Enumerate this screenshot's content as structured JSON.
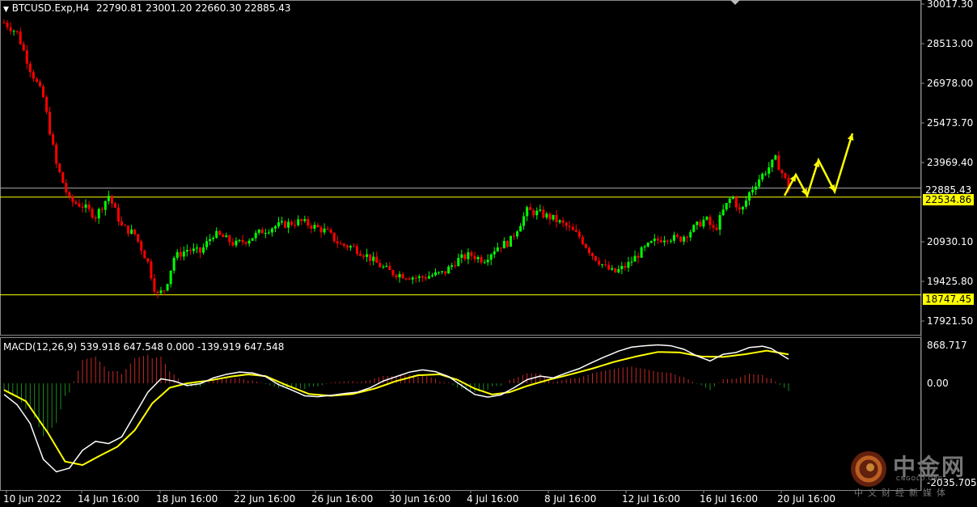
{
  "header": {
    "symbol": "BTCUSD.Exp,H4",
    "ohlc": "22790.81 23001.20 22660.30 22885.43"
  },
  "price_axis": [
    "30017.30",
    "28513.00",
    "26978.00",
    "25473.70",
    "23969.40",
    "20930.10",
    "19425.80",
    "17921.50"
  ],
  "levels": {
    "current": "22885.43",
    "resistance": "22534.86",
    "support": "18747.45"
  },
  "macd": {
    "label": "MACD(12,26,9) 539.918 647.548 0.000 -139.919 647.548",
    "axis_top": "868.717",
    "axis_zero": "0.00",
    "axis_bottom": "-2035.705"
  },
  "time_axis": [
    "10 Jun 2022",
    "14 Jun 16:00",
    "18 Jun 16:00",
    "22 Jun 16:00",
    "26 Jun 16:00",
    "30 Jun 16:00",
    "4 Jul 16:00",
    "8 Jul 16:00",
    "12 Jul 16:00",
    "16 Jul 16:00",
    "20 Jul 16:00"
  ],
  "watermark": {
    "brand": "中金网",
    "site": "CNGOLD.ORG",
    "tagline": "中文财经新媒体"
  },
  "colors": {
    "bull": "#00ff00",
    "bear": "#ff0000",
    "hist_pos": "#c62828",
    "hist_neg": "#1b8a1b",
    "macd_line": "#ffffff",
    "signal_line": "#ffff00",
    "level": "#ffff00",
    "arrow": "#ffff00"
  },
  "chart_data": {
    "type": "candlestick",
    "title": "BTCUSD.Exp,H4",
    "y_range": [
      17500,
      30100
    ],
    "close_path": [
      {
        "t": 0,
        "p": 29300
      },
      {
        "t": 6,
        "p": 28900
      },
      {
        "t": 12,
        "p": 27500
      },
      {
        "t": 18,
        "p": 26400
      },
      {
        "t": 24,
        "p": 23800
      },
      {
        "t": 30,
        "p": 22400
      },
      {
        "t": 36,
        "p": 22200
      },
      {
        "t": 42,
        "p": 21800
      },
      {
        "t": 48,
        "p": 22600
      },
      {
        "t": 54,
        "p": 21400
      },
      {
        "t": 60,
        "p": 21100
      },
      {
        "t": 66,
        "p": 20000
      },
      {
        "t": 70,
        "p": 18700
      },
      {
        "t": 74,
        "p": 19000
      },
      {
        "t": 78,
        "p": 20200
      },
      {
        "t": 84,
        "p": 20500
      },
      {
        "t": 90,
        "p": 20400
      },
      {
        "t": 96,
        "p": 21100
      },
      {
        "t": 100,
        "p": 21000
      },
      {
        "t": 106,
        "p": 20700
      },
      {
        "t": 112,
        "p": 20900
      },
      {
        "t": 118,
        "p": 21200
      },
      {
        "t": 124,
        "p": 21400
      },
      {
        "t": 130,
        "p": 21500
      },
      {
        "t": 136,
        "p": 21600
      },
      {
        "t": 142,
        "p": 21400
      },
      {
        "t": 148,
        "p": 21200
      },
      {
        "t": 154,
        "p": 20700
      },
      {
        "t": 160,
        "p": 20600
      },
      {
        "t": 166,
        "p": 20300
      },
      {
        "t": 172,
        "p": 19900
      },
      {
        "t": 178,
        "p": 19600
      },
      {
        "t": 184,
        "p": 19500
      },
      {
        "t": 190,
        "p": 19400
      },
      {
        "t": 196,
        "p": 19500
      },
      {
        "t": 202,
        "p": 19600
      },
      {
        "t": 208,
        "p": 20100
      },
      {
        "t": 214,
        "p": 20300
      },
      {
        "t": 220,
        "p": 20100
      },
      {
        "t": 226,
        "p": 20600
      },
      {
        "t": 232,
        "p": 20800
      },
      {
        "t": 236,
        "p": 21400
      },
      {
        "t": 240,
        "p": 22000
      },
      {
        "t": 246,
        "p": 21900
      },
      {
        "t": 252,
        "p": 21700
      },
      {
        "t": 258,
        "p": 21400
      },
      {
        "t": 264,
        "p": 21000
      },
      {
        "t": 270,
        "p": 20300
      },
      {
        "t": 276,
        "p": 19800
      },
      {
        "t": 280,
        "p": 19600
      },
      {
        "t": 286,
        "p": 19900
      },
      {
        "t": 292,
        "p": 20400
      },
      {
        "t": 298,
        "p": 20800
      },
      {
        "t": 304,
        "p": 21000
      },
      {
        "t": 310,
        "p": 20900
      },
      {
        "t": 316,
        "p": 21300
      },
      {
        "t": 322,
        "p": 21700
      },
      {
        "t": 326,
        "p": 21200
      },
      {
        "t": 330,
        "p": 22000
      },
      {
        "t": 334,
        "p": 22600
      },
      {
        "t": 338,
        "p": 21900
      },
      {
        "t": 342,
        "p": 22700
      },
      {
        "t": 346,
        "p": 23200
      },
      {
        "t": 350,
        "p": 23600
      },
      {
        "t": 354,
        "p": 24000
      },
      {
        "t": 358,
        "p": 23300
      },
      {
        "t": 360,
        "p": 22885
      }
    ],
    "macd_line": [
      {
        "t": 0,
        "v": -250
      },
      {
        "t": 6,
        "v": -480
      },
      {
        "t": 12,
        "v": -900
      },
      {
        "t": 18,
        "v": -1700
      },
      {
        "t": 24,
        "v": -1980
      },
      {
        "t": 30,
        "v": -1900
      },
      {
        "t": 36,
        "v": -1500
      },
      {
        "t": 42,
        "v": -1300
      },
      {
        "t": 48,
        "v": -1350
      },
      {
        "t": 54,
        "v": -1200
      },
      {
        "t": 60,
        "v": -700
      },
      {
        "t": 66,
        "v": -200
      },
      {
        "t": 72,
        "v": 100
      },
      {
        "t": 78,
        "v": 50
      },
      {
        "t": 84,
        "v": -50
      },
      {
        "t": 90,
        "v": -10
      },
      {
        "t": 96,
        "v": 120
      },
      {
        "t": 102,
        "v": 200
      },
      {
        "t": 108,
        "v": 250
      },
      {
        "t": 114,
        "v": 230
      },
      {
        "t": 120,
        "v": 150
      },
      {
        "t": 126,
        "v": -30
      },
      {
        "t": 132,
        "v": -150
      },
      {
        "t": 138,
        "v": -280
      },
      {
        "t": 144,
        "v": -300
      },
      {
        "t": 150,
        "v": -270
      },
      {
        "t": 156,
        "v": -230
      },
      {
        "t": 162,
        "v": -200
      },
      {
        "t": 168,
        "v": -100
      },
      {
        "t": 174,
        "v": 50
      },
      {
        "t": 180,
        "v": 150
      },
      {
        "t": 186,
        "v": 250
      },
      {
        "t": 192,
        "v": 300
      },
      {
        "t": 198,
        "v": 260
      },
      {
        "t": 204,
        "v": 150
      },
      {
        "t": 210,
        "v": -50
      },
      {
        "t": 216,
        "v": -250
      },
      {
        "t": 222,
        "v": -310
      },
      {
        "t": 228,
        "v": -260
      },
      {
        "t": 234,
        "v": -100
      },
      {
        "t": 240,
        "v": 80
      },
      {
        "t": 246,
        "v": 160
      },
      {
        "t": 252,
        "v": 120
      },
      {
        "t": 258,
        "v": 230
      },
      {
        "t": 264,
        "v": 330
      },
      {
        "t": 270,
        "v": 470
      },
      {
        "t": 276,
        "v": 600
      },
      {
        "t": 282,
        "v": 720
      },
      {
        "t": 288,
        "v": 810
      },
      {
        "t": 294,
        "v": 840
      },
      {
        "t": 300,
        "v": 860
      },
      {
        "t": 306,
        "v": 840
      },
      {
        "t": 312,
        "v": 760
      },
      {
        "t": 318,
        "v": 610
      },
      {
        "t": 324,
        "v": 500
      },
      {
        "t": 330,
        "v": 650
      },
      {
        "t": 336,
        "v": 690
      },
      {
        "t": 342,
        "v": 800
      },
      {
        "t": 348,
        "v": 830
      },
      {
        "t": 352,
        "v": 780
      },
      {
        "t": 356,
        "v": 660
      },
      {
        "t": 360,
        "v": 540
      }
    ],
    "signal_line": [
      {
        "t": 0,
        "v": -150
      },
      {
        "t": 10,
        "v": -400
      },
      {
        "t": 20,
        "v": -1100
      },
      {
        "t": 28,
        "v": -1750
      },
      {
        "t": 36,
        "v": -1830
      },
      {
        "t": 44,
        "v": -1620
      },
      {
        "t": 52,
        "v": -1420
      },
      {
        "t": 60,
        "v": -1050
      },
      {
        "t": 68,
        "v": -450
      },
      {
        "t": 76,
        "v": -100
      },
      {
        "t": 84,
        "v": 0
      },
      {
        "t": 94,
        "v": 60
      },
      {
        "t": 104,
        "v": 150
      },
      {
        "t": 112,
        "v": 200
      },
      {
        "t": 120,
        "v": 160
      },
      {
        "t": 130,
        "v": -50
      },
      {
        "t": 140,
        "v": -240
      },
      {
        "t": 150,
        "v": -280
      },
      {
        "t": 160,
        "v": -240
      },
      {
        "t": 170,
        "v": -120
      },
      {
        "t": 180,
        "v": 50
      },
      {
        "t": 190,
        "v": 180
      },
      {
        "t": 200,
        "v": 200
      },
      {
        "t": 208,
        "v": 80
      },
      {
        "t": 216,
        "v": -120
      },
      {
        "t": 224,
        "v": -250
      },
      {
        "t": 232,
        "v": -200
      },
      {
        "t": 240,
        "v": -60
      },
      {
        "t": 250,
        "v": 80
      },
      {
        "t": 260,
        "v": 200
      },
      {
        "t": 270,
        "v": 330
      },
      {
        "t": 280,
        "v": 480
      },
      {
        "t": 290,
        "v": 600
      },
      {
        "t": 300,
        "v": 700
      },
      {
        "t": 310,
        "v": 690
      },
      {
        "t": 320,
        "v": 600
      },
      {
        "t": 330,
        "v": 590
      },
      {
        "t": 340,
        "v": 650
      },
      {
        "t": 350,
        "v": 730
      },
      {
        "t": 360,
        "v": 647
      }
    ]
  }
}
